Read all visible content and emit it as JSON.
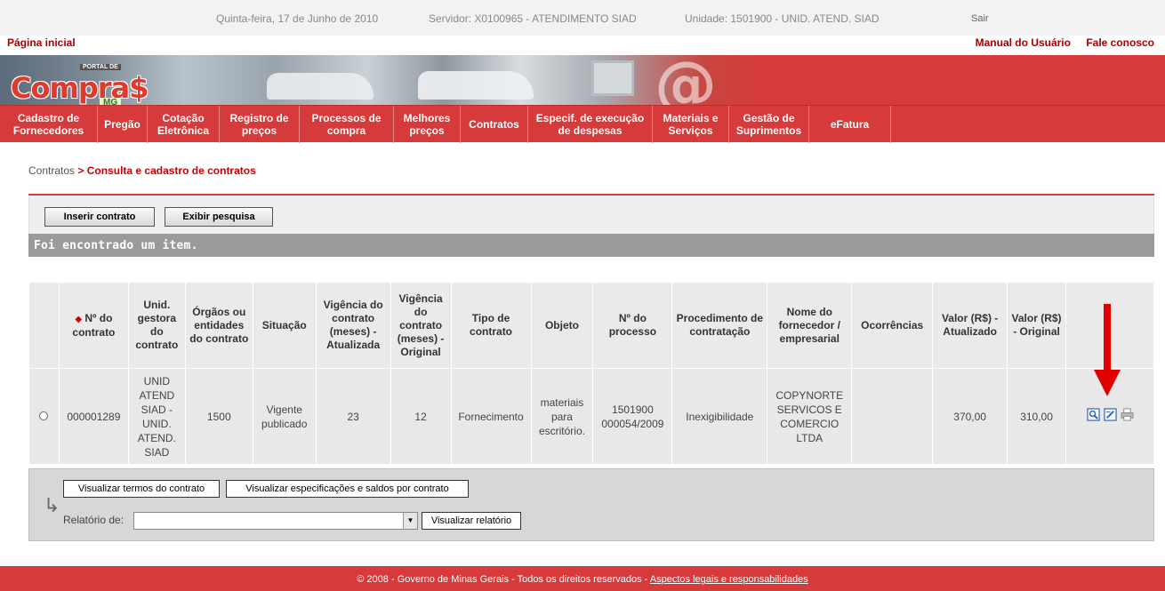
{
  "topbar": {
    "date": "Quinta-feira, 17 de Junho de 2010",
    "server": "Servidor: X0100965 - ATENDIMENTO SIAD",
    "unit": "Unidade: 1501900 - UNID. ATEND. SIAD",
    "logout": "Sair"
  },
  "links": {
    "home": "Página inicial",
    "manual": "Manual do Usuário",
    "contact": "Fale conosco"
  },
  "logo": {
    "portal": "PORTAL DE",
    "name": "Compra$",
    "state": "MG"
  },
  "menu": [
    {
      "l1": "Cadastro de",
      "l2": "Fornecedores"
    },
    {
      "l1": "Pregão",
      "l2": ""
    },
    {
      "l1": "Cotação",
      "l2": "Eletrônica"
    },
    {
      "l1": "Registro de",
      "l2": "preços"
    },
    {
      "l1": "Processos de",
      "l2": "compra"
    },
    {
      "l1": "Melhores",
      "l2": "preços"
    },
    {
      "l1": "Contratos",
      "l2": ""
    },
    {
      "l1": "Especif. de execução",
      "l2": "de despesas"
    },
    {
      "l1": "Materiais e",
      "l2": "Serviços"
    },
    {
      "l1": "Gestão de",
      "l2": "Suprimentos"
    },
    {
      "l1": "eFatura",
      "l2": ""
    }
  ],
  "breadcrumb": {
    "parent": "Contratos",
    "sep": ">",
    "current": "Consulta e cadastro de contratos"
  },
  "actions": {
    "insert": "Inserir contrato",
    "search": "Exibir pesquisa"
  },
  "result_text": "Foi encontrado um item.",
  "table": {
    "headers": {
      "contract_no": "Nº do contrato",
      "unit": "Unid. gestora do contrato",
      "organs": "Órgãos ou entidades do contrato",
      "status": "Situação",
      "vig_upd": "Vigência do contrato (meses) - Atualizada",
      "vig_orig": "Vigência do contrato (meses) - Original",
      "type": "Tipo de contrato",
      "object": "Objeto",
      "process": "Nº do processo",
      "procedure": "Procedimento de contratação",
      "supplier": "Nome do fornecedor / empresarial",
      "occurrences": "Ocorrências",
      "val_upd": "Valor (R$) - Atualizado",
      "val_orig": "Valor (R$) - Original"
    },
    "row": {
      "contract_no": "000001289",
      "unit": "UNID ATEND SIAD - UNID. ATEND. SIAD",
      "organs": "1500",
      "status": "Vigente publicado",
      "vig_upd": "23",
      "vig_orig": "12",
      "type": "Fornecimento",
      "object": "materiais para escritório.",
      "process": "1501900 000054/2009",
      "procedure": "Inexigibilidade",
      "supplier": "COPYNORTE SERVICOS E COMERCIO LTDA",
      "occurrences": "",
      "val_upd": "370,00",
      "val_orig": "310,00",
      "icons": [
        "view-icon",
        "edit-icon",
        "print-icon"
      ]
    }
  },
  "subpanel": {
    "terms_btn": "Visualizar termos do contrato",
    "specs_btn": "Visualizar especificações e saldos por contrato",
    "report_label": "Relatório de:",
    "report_value": "",
    "report_btn": "Visualizar relatório"
  },
  "footer": {
    "text": "© 2008 - Governo de Minas Gerais - Todos os direitos reservados - ",
    "link": "Aspectos legais e responsabilidades"
  },
  "colors": {
    "brand_red": "#d73a3a",
    "result_bar": "#9a9a9a",
    "annotation_arrow": "#e00000"
  }
}
